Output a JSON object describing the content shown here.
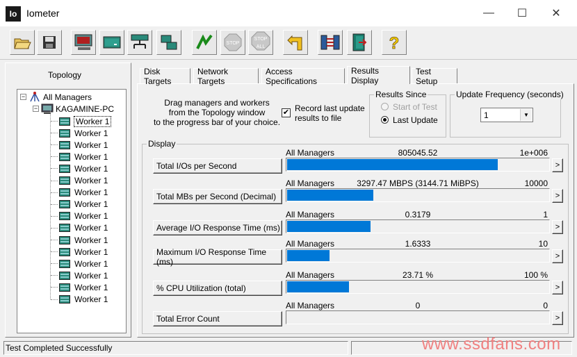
{
  "window": {
    "title": "Iometer",
    "app_icon_text": "Io",
    "minimize": "—",
    "maximize": "☐",
    "close": "✕"
  },
  "toolbar": {
    "buttons": [
      {
        "name": "open-icon"
      },
      {
        "name": "save-icon"
      },
      {
        "name": "new-disk-worker-icon"
      },
      {
        "name": "new-network-worker-icon"
      },
      {
        "name": "new-manager-icon"
      },
      {
        "name": "duplicate-worker-icon"
      },
      {
        "name": "start-icon"
      },
      {
        "name": "stop-icon",
        "text": "STOP"
      },
      {
        "name": "stop-all-icon",
        "text_top": "STOP",
        "text_bottom": "ALL"
      },
      {
        "name": "reset-workers-icon"
      },
      {
        "name": "disconnect-icon"
      },
      {
        "name": "exit-icon"
      },
      {
        "name": "help-icon",
        "text": "?"
      }
    ]
  },
  "topology": {
    "title": "Topology",
    "root": "All Managers",
    "manager": "KAGAMINE-PC",
    "expand_symbol": "−",
    "workers": [
      "Worker 1",
      "Worker 1",
      "Worker 1",
      "Worker 1",
      "Worker 1",
      "Worker 1",
      "Worker 1",
      "Worker 1",
      "Worker 1",
      "Worker 1",
      "Worker 1",
      "Worker 1",
      "Worker 1",
      "Worker 1",
      "Worker 1",
      "Worker 1"
    ]
  },
  "tabs": [
    "Disk Targets",
    "Network Targets",
    "Access Specifications",
    "Results Display",
    "Test Setup"
  ],
  "active_tab": "Results Display",
  "results": {
    "drag_hint": "Drag managers and workers\nfrom the Topology window\nto the progress bar of your choice.",
    "record_label": "Record last update\nresults to file",
    "record_checked": true,
    "checkmark": "✔",
    "results_since": {
      "title": "Results Since",
      "options": [
        "Start of Test",
        "Last Update"
      ],
      "selected": "Last Update"
    },
    "update_frequency": {
      "title": "Update Frequency (seconds)",
      "value": "1",
      "arrow": "▼"
    },
    "display_title": "Display",
    "more_symbol": ">",
    "rows": [
      {
        "button": "Total I/Os per Second",
        "source": "All Managers",
        "value": "805045.52",
        "max": "1e+006",
        "fill": 0.805
      },
      {
        "button": "Total MBs per Second (Decimal)",
        "source": "All Managers",
        "value": "3297.47 MBPS (3144.71 MiBPS)",
        "max": "10000",
        "fill": 0.33
      },
      {
        "button": "Average I/O Response Time (ms)",
        "source": "All Managers",
        "value": "0.3179",
        "max": "1",
        "fill": 0.318
      },
      {
        "button": "Maximum I/O Response Time (ms)",
        "source": "All Managers",
        "value": "1.6333",
        "max": "10",
        "fill": 0.163
      },
      {
        "button": "% CPU Utilization (total)",
        "source": "All Managers",
        "value": "23.71 %",
        "max": "100 %",
        "fill": 0.237
      },
      {
        "button": "Total Error Count",
        "source": "All Managers",
        "value": "0",
        "max": "0",
        "fill": 0
      }
    ]
  },
  "status": {
    "text": "Test Completed Successfully"
  },
  "watermark": "www.ssdfans.com",
  "colors": {
    "bar": "#0078d7",
    "watermark": "#f08080",
    "accent_green": "#2ca02c",
    "help_yellow": "#f5d000"
  }
}
